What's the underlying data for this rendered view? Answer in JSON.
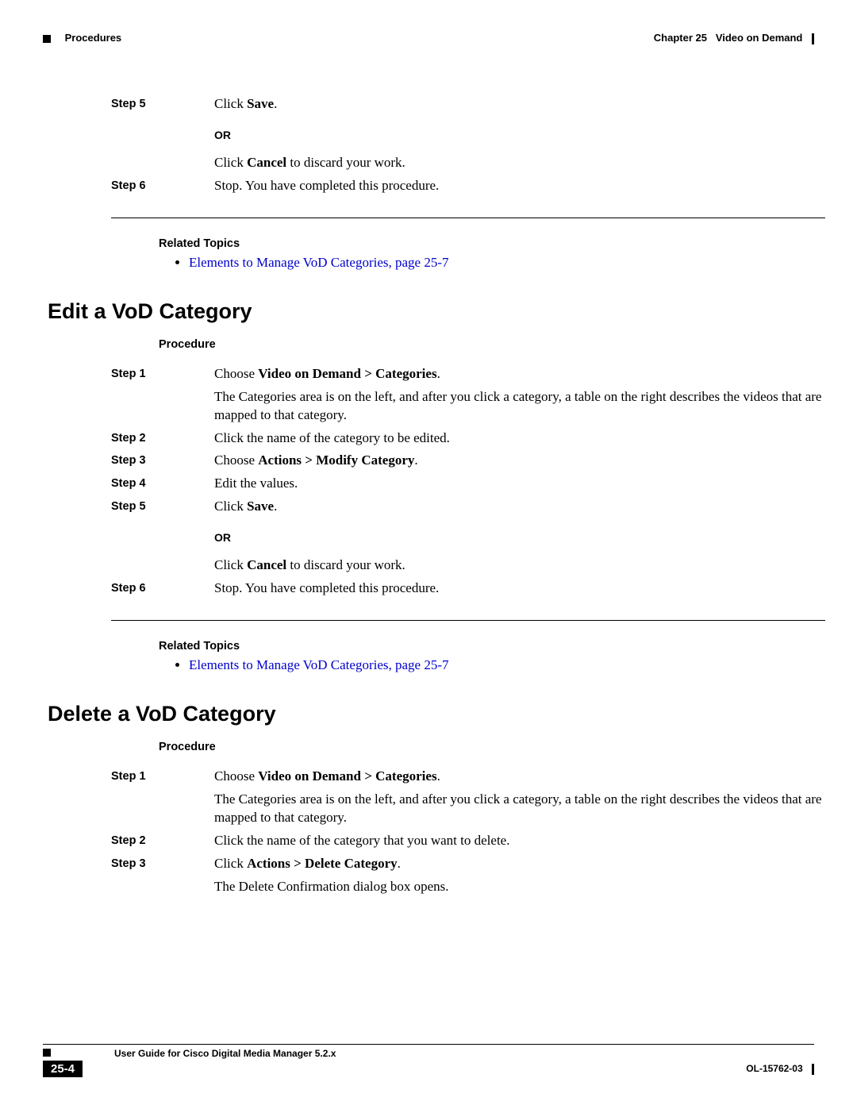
{
  "header": {
    "left_section": "Procedures",
    "chapter": "Chapter 25",
    "chapter_title": "Video on Demand"
  },
  "section_a": {
    "step5_label": "Step 5",
    "step5_pre": "Click ",
    "step5_bold": "Save",
    "step5_post": ".",
    "or": "OR",
    "cancel_pre": "Click ",
    "cancel_bold": "Cancel",
    "cancel_post": " to discard your work.",
    "step6_label": "Step 6",
    "step6_text": "Stop. You have completed this procedure.",
    "related_heading": "Related Topics",
    "related_link": "Elements to Manage VoD Categories, page 25-7"
  },
  "section_b": {
    "heading": "Edit a VoD Category",
    "procedure_heading": "Procedure",
    "step1_label": "Step 1",
    "step1_pre": "Choose ",
    "step1_bold": "Video on Demand > Categories",
    "step1_post": ".",
    "step1_desc": "The Categories area is on the left, and after you click a category, a table on the right describes the videos that are mapped to that category.",
    "step2_label": "Step 2",
    "step2_text": "Click the name of the category to be edited.",
    "step3_label": "Step 3",
    "step3_pre": "Choose ",
    "step3_bold": "Actions > Modify Category",
    "step3_post": ".",
    "step4_label": "Step 4",
    "step4_text": "Edit the values.",
    "step5_label": "Step 5",
    "step5_pre": "Click ",
    "step5_bold": "Save",
    "step5_post": ".",
    "or": "OR",
    "cancel_pre": "Click ",
    "cancel_bold": "Cancel",
    "cancel_post": " to discard your work.",
    "step6_label": "Step 6",
    "step6_text": "Stop. You have completed this procedure.",
    "related_heading": "Related Topics",
    "related_link": "Elements to Manage VoD Categories, page 25-7"
  },
  "section_c": {
    "heading": "Delete a VoD Category",
    "procedure_heading": "Procedure",
    "step1_label": "Step 1",
    "step1_pre": "Choose ",
    "step1_bold": "Video on Demand > Categories",
    "step1_post": ".",
    "step1_desc": "The Categories area is on the left, and after you click a category, a table on the right describes the videos that are mapped to that category.",
    "step2_label": "Step 2",
    "step2_text": "Click the name of the category that you want to delete.",
    "step3_label": "Step 3",
    "step3_pre": "Click ",
    "step3_bold": "Actions > Delete Category",
    "step3_post": ".",
    "step3_desc": "The Delete Confirmation dialog box opens."
  },
  "footer": {
    "guide_title": "User Guide for Cisco Digital Media Manager 5.2.x",
    "page_number": "25-4",
    "doc_id": "OL-15762-03"
  }
}
